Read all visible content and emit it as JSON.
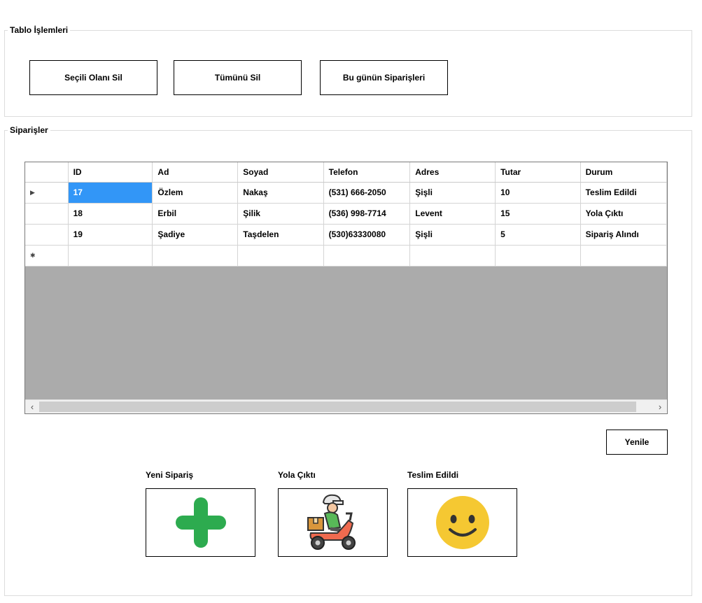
{
  "table_ops": {
    "title": "Tablo İşlemleri",
    "delete_selected": "Seçili Olanı Sil",
    "delete_all": "Tümünü Sil",
    "todays_orders": "Bu günün Siparişleri"
  },
  "orders": {
    "title": "Siparişler",
    "columns": [
      "ID",
      "Ad",
      "Soyad",
      "Telefon",
      "Adres",
      "Tutar",
      "Durum"
    ],
    "rows": [
      [
        "17",
        "Özlem",
        "Nakaş",
        "(531) 666-2050",
        "Şişli",
        "10",
        "Teslim Edildi"
      ],
      [
        "18",
        "Erbil",
        "Şilik",
        "(536) 998-7714",
        "Levent",
        "15",
        "Yola Çıktı"
      ],
      [
        "19",
        "Şadiye",
        "Taşdelen",
        "(530)63330080",
        "Şişli",
        "5",
        "Sipariş Alındı"
      ]
    ],
    "refresh": "Yenile",
    "status_buttons": {
      "new_label": "Yeni Sipariş",
      "on_road_label": "Yola Çıktı",
      "delivered_label": "Teslim Edildi",
      "new_icon": "plus-icon",
      "on_road_icon": "delivery-scooter-icon",
      "delivered_icon": "smiley-face-icon"
    }
  },
  "colors": {
    "selection": "#3296f7",
    "grid_background": "#ababab",
    "plus": "#2dab4f",
    "smiley": "#f5c832"
  }
}
